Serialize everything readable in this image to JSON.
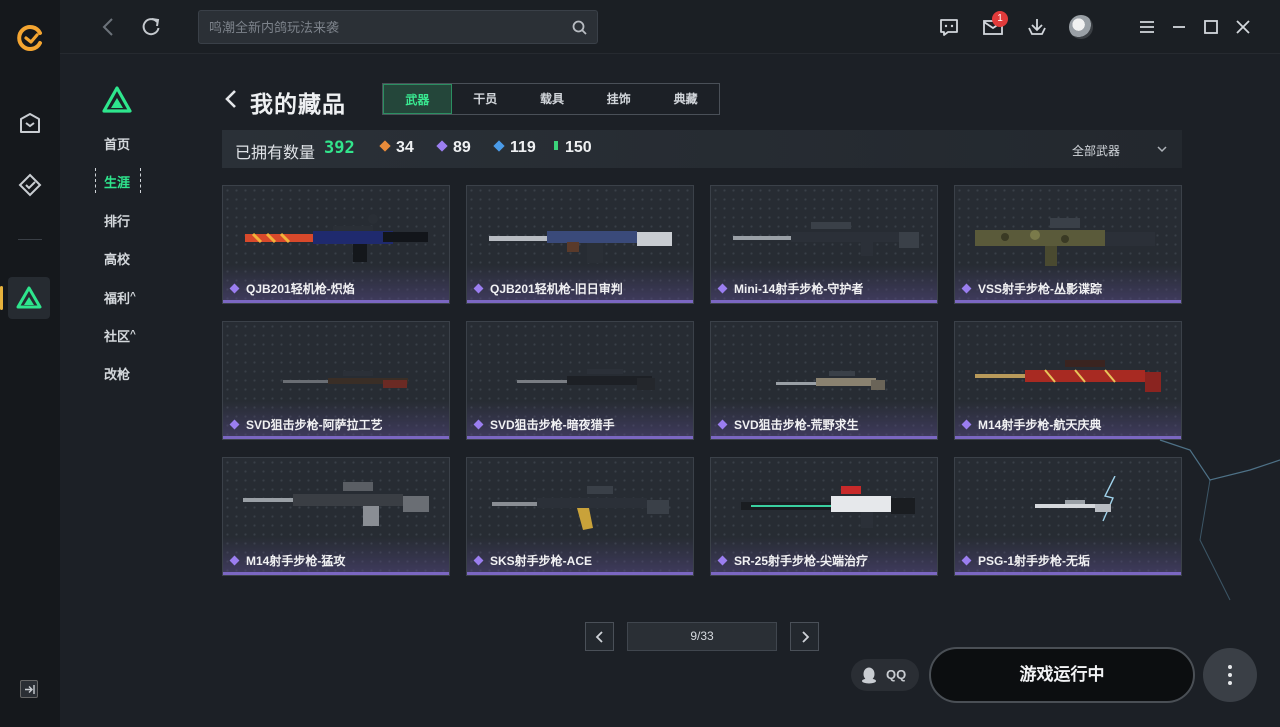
{
  "topbar": {
    "search_placeholder": "鸣潮全新内鸽玩法来袭",
    "icons": [
      "back-icon",
      "refresh-icon",
      "search-icon",
      "chat-icon",
      "mail-icon",
      "download-icon",
      "avatar",
      "menu-icon",
      "minimize-icon",
      "maximize-icon",
      "close-icon"
    ],
    "mail_badge": "1"
  },
  "rail": {
    "icons": [
      "wegame-logo-icon",
      "bag-icon",
      "game-library-icon",
      "delta-force-app-icon",
      "collapse-icon"
    ]
  },
  "sidebar": {
    "items": [
      {
        "label": "首页"
      },
      {
        "label": "生涯",
        "active": true
      },
      {
        "label": "排行"
      },
      {
        "label": "高校"
      },
      {
        "label": "福利",
        "suffix": "^"
      },
      {
        "label": "社区",
        "suffix": "^"
      },
      {
        "label": "改枪"
      }
    ]
  },
  "page": {
    "title": "我的藏品",
    "tabs": [
      "武器",
      "干员",
      "载具",
      "挂饰",
      "典藏"
    ],
    "active_tab": 0
  },
  "stats": {
    "owned_label": "已拥有数量",
    "owned_total": "392",
    "tiers": [
      {
        "value": "34",
        "color": "#e98b3a"
      },
      {
        "value": "89",
        "color": "#9b7ef0"
      },
      {
        "value": "119",
        "color": "#4a9be8"
      },
      {
        "value": "150",
        "color": "#3bd37a"
      }
    ],
    "filter_label": "全部武器"
  },
  "cards": [
    {
      "name": "QJB201轻机枪-炽焰"
    },
    {
      "name": "QJB201轻机枪-旧日审判"
    },
    {
      "name": "Mini-14射手步枪-守护者"
    },
    {
      "name": "VSS射手步枪-丛影谍踪"
    },
    {
      "name": "SVD狙击步枪-阿萨拉工艺"
    },
    {
      "name": "SVD狙击步枪-暗夜猎手"
    },
    {
      "name": "SVD狙击步枪-荒野求生"
    },
    {
      "name": "M14射手步枪-航天庆典"
    },
    {
      "name": "M14射手步枪-猛攻"
    },
    {
      "name": "SKS射手步枪-ACE"
    },
    {
      "name": "SR-25射手步枪-尖端治疗"
    },
    {
      "name": "PSG-1射手步枪-无垢"
    }
  ],
  "pagination": {
    "current": "9/33"
  },
  "bottom": {
    "qq_label": "QQ",
    "run_label": "游戏运行中"
  },
  "colors": {
    "accent": "#2ee68d",
    "rarity_purple": "#9b7ef0"
  }
}
